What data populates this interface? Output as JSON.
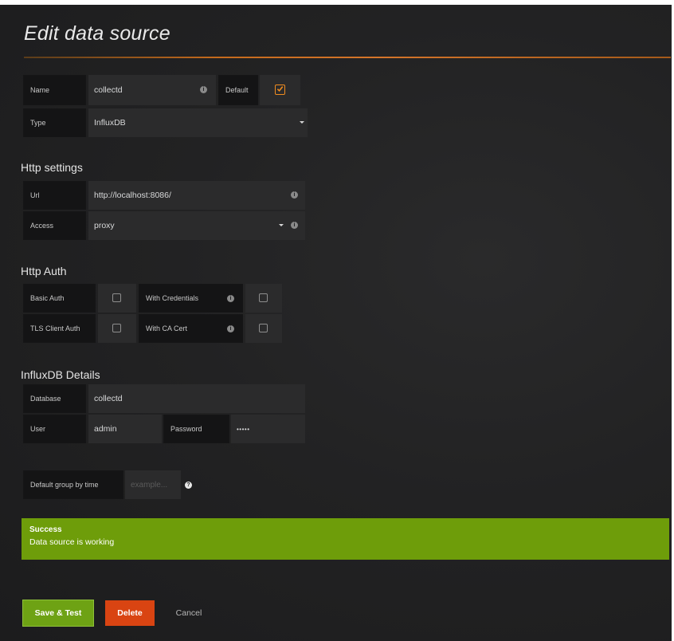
{
  "page": {
    "title": "Edit data source"
  },
  "general": {
    "name_label": "Name",
    "name_value": "collectd",
    "default_label": "Default",
    "default_checked": true,
    "type_label": "Type",
    "type_value": "InfluxDB"
  },
  "http_settings": {
    "heading": "Http settings",
    "url_label": "Url",
    "url_value": "http://localhost:8086/",
    "access_label": "Access",
    "access_value": "proxy"
  },
  "http_auth": {
    "heading": "Http Auth",
    "basic_auth_label": "Basic Auth",
    "with_credentials_label": "With Credentials",
    "tls_client_auth_label": "TLS Client Auth",
    "with_ca_cert_label": "With CA Cert"
  },
  "influxdb": {
    "heading": "InfluxDB Details",
    "database_label": "Database",
    "database_value": "collectd",
    "user_label": "User",
    "user_value": "admin",
    "password_label": "Password",
    "password_value": "•••••"
  },
  "group_by": {
    "label": "Default group by time",
    "placeholder": "example..."
  },
  "alert": {
    "title": "Success",
    "message": "Data source is working"
  },
  "buttons": {
    "save": "Save & Test",
    "delete": "Delete",
    "cancel": "Cancel"
  },
  "colors": {
    "accent": "#f08c1f",
    "success": "#6e9d0a",
    "save_button": "#6ea214",
    "delete_button": "#d94412"
  },
  "icons": {
    "info": "info-icon",
    "caret": "caret-down-icon",
    "check": "checkmark-icon"
  }
}
